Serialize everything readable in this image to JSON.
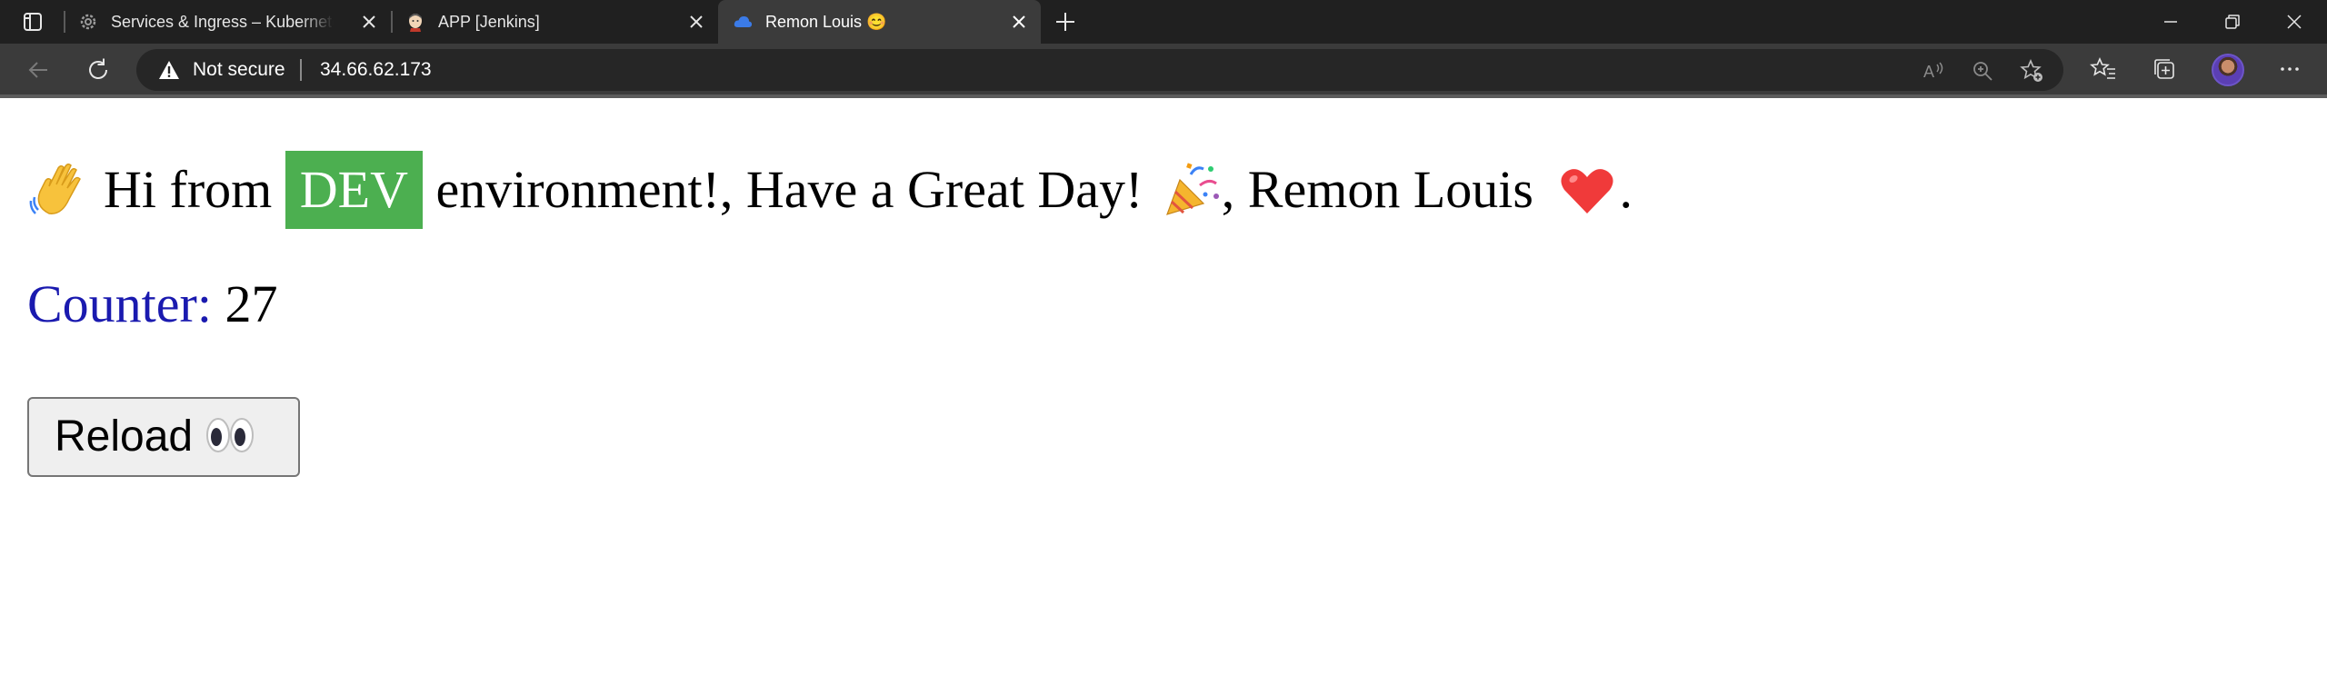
{
  "browser": {
    "tabs": [
      {
        "title": "Services & Ingress – Kubernetes",
        "icon": "kubernetes-gear-icon"
      },
      {
        "title": "APP [Jenkins]",
        "icon": "jenkins-icon"
      },
      {
        "title": "Remon Louis 😊",
        "icon": "cloud-icon",
        "active": true
      }
    ],
    "address": {
      "security_label": "Not secure",
      "url": "34.66.62.173"
    }
  },
  "page": {
    "greeting_prefix": "Hi from",
    "environment": "DEV",
    "greeting_middle": "environment!, Have a Great Day!",
    "greeting_name": ", Remon Louis",
    "greeting_end": ".",
    "counter_label": "Counter:",
    "counter_value": "27",
    "reload_label": "Reload",
    "badge_color": "#4caf50",
    "counter_label_color": "#1a1aaf"
  }
}
